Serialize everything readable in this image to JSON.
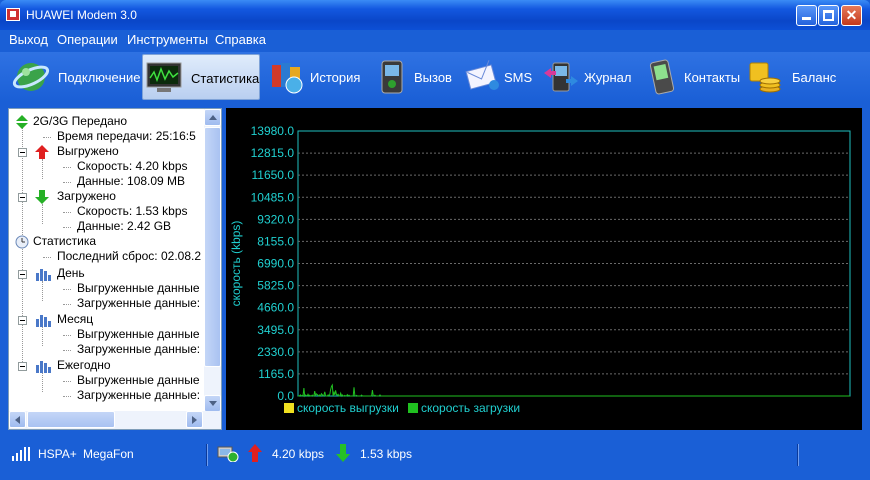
{
  "window": {
    "title": "HUAWEI Modem 3.0"
  },
  "menu": [
    "Выход",
    "Операции",
    "Инструменты",
    "Справка"
  ],
  "toolbar": [
    {
      "label": "Подключение",
      "icon": "connection-globe-icon"
    },
    {
      "label": "Статистика",
      "icon": "statistics-monitor-icon",
      "active": true
    },
    {
      "label": "История",
      "icon": "history-books-icon"
    },
    {
      "label": "Вызов",
      "icon": "call-phone-icon"
    },
    {
      "label": "SMS",
      "icon": "sms-envelope-icon"
    },
    {
      "label": "Журнал",
      "icon": "log-phone-arrows-icon"
    },
    {
      "label": "Контакты",
      "icon": "contacts-phone-icon"
    },
    {
      "label": "Баланс",
      "icon": "balance-coins-icon"
    }
  ],
  "tree": {
    "transferred": "2G/3G Передано",
    "time": "Время передачи: 25:16:5",
    "uploaded": "Выгружено",
    "up_speed": "Скорость: 4.20 kbps",
    "up_data": "Данные: 108.09 MB",
    "downloaded": "Загружено",
    "down_speed": "Скорость: 1.53 kbps",
    "down_data": "Данные: 2.42 GB",
    "statistics": "Статистика",
    "last_reset": "Последний сброс: 02.08.2",
    "day": "День",
    "day_up": "Выгруженные данные",
    "day_down": "Загруженные данные:",
    "month": "Месяц",
    "month_up": "Выгруженные данные",
    "month_down": "Загруженные данные:",
    "yearly": "Ежегодно",
    "year_up": "Выгруженные данные",
    "year_down": "Загруженные данные:"
  },
  "chart_data": {
    "type": "line",
    "ylabel": "скорость (kbps)",
    "ylim": [
      0,
      13980
    ],
    "y_ticks": [
      "13980.0",
      "12815.0",
      "11650.0",
      "10485.0",
      "9320.0",
      "8155.0",
      "6990.0",
      "5825.0",
      "4660.0",
      "3495.0",
      "2330.0",
      "1165.0",
      "0.0"
    ],
    "grid": true,
    "legend": [
      {
        "name": "скорость выгрузки",
        "color": "#f0e020"
      },
      {
        "name": "скорость загрузки",
        "color": "#20c020"
      }
    ],
    "series": [
      {
        "name": "скорость загрузки",
        "color": "#20c020",
        "values": [
          0,
          0,
          20,
          60,
          0,
          30,
          0,
          420,
          0,
          60,
          20,
          0,
          90,
          0,
          40,
          0,
          0,
          50,
          0,
          0,
          260,
          30,
          110,
          80,
          40,
          0,
          60,
          0,
          120,
          70,
          0,
          40,
          220,
          0,
          0,
          0,
          60,
          0,
          80,
          330,
          510,
          580,
          0,
          190,
          60,
          300,
          70,
          40,
          90,
          0,
          0,
          150,
          0,
          60,
          0,
          0,
          30,
          0,
          0,
          70,
          0,
          40,
          0,
          0,
          0,
          0,
          0,
          460,
          0,
          0,
          30,
          0,
          0,
          0,
          0,
          0,
          50,
          0,
          0,
          0,
          0,
          0,
          0,
          0,
          0,
          0,
          0,
          0,
          0,
          310,
          0,
          0,
          40,
          0,
          0,
          0,
          0,
          0,
          60,
          0,
          0,
          0,
          0,
          0,
          0,
          0,
          0,
          0,
          0,
          0,
          0,
          0,
          0,
          0,
          0,
          0,
          0,
          0,
          0,
          0,
          0,
          0,
          0,
          0,
          0,
          0,
          0,
          0,
          0,
          0,
          0,
          0,
          0,
          0,
          0,
          0,
          0,
          0,
          0,
          0,
          0,
          0,
          0,
          0,
          0,
          0,
          0,
          0,
          0,
          0,
          0,
          0,
          0,
          0,
          0,
          0,
          0,
          0,
          0,
          0,
          0,
          0,
          0,
          0,
          0,
          0,
          0,
          0,
          0,
          0,
          0,
          0,
          0,
          0,
          0,
          0,
          0,
          0,
          0,
          0,
          0,
          0,
          0,
          0,
          0,
          0,
          0,
          0,
          0,
          0,
          0,
          0,
          0,
          0,
          0,
          0,
          0,
          0,
          0,
          0,
          0,
          0,
          0,
          0,
          0,
          0,
          0,
          0,
          0,
          0,
          0,
          0,
          0,
          0,
          0,
          0,
          0,
          0,
          0,
          0,
          0,
          0,
          0,
          0,
          0,
          0,
          0,
          0,
          0,
          0,
          0,
          0,
          0,
          0,
          0,
          0,
          0,
          0,
          0,
          0,
          0,
          0,
          0,
          0,
          0,
          0,
          0,
          0,
          0,
          0,
          0,
          0,
          0,
          0,
          0,
          0,
          0,
          0,
          0,
          0,
          0,
          0,
          0,
          0,
          0,
          0,
          0,
          0,
          0,
          0,
          0,
          0,
          0,
          0,
          0,
          0,
          0,
          0,
          0,
          0,
          0,
          0,
          0,
          0,
          0,
          0,
          0,
          0,
          0,
          0,
          0,
          0,
          0,
          0,
          0,
          0,
          0,
          0,
          0,
          0,
          0,
          0,
          0,
          0,
          0,
          0,
          0,
          0,
          0,
          0,
          0,
          0,
          0,
          0,
          0,
          0,
          0,
          0,
          0,
          0,
          0,
          0,
          0,
          0,
          0,
          0,
          0,
          0,
          0,
          0,
          0,
          0,
          0,
          0,
          0,
          0,
          0,
          0,
          0,
          0,
          0,
          0,
          0,
          0,
          0,
          0,
          0,
          0,
          0,
          0,
          0,
          0,
          0,
          0,
          0,
          0,
          0,
          0,
          0,
          0,
          0,
          0,
          0,
          0,
          0,
          0,
          0,
          0,
          0,
          0,
          0,
          0,
          0,
          0,
          0,
          0,
          0,
          0,
          0,
          0,
          0,
          0,
          0,
          0,
          0,
          0,
          0,
          0,
          0,
          0,
          0,
          0,
          0,
          0,
          0,
          0,
          0,
          0,
          0,
          0,
          0,
          0,
          0,
          0,
          0,
          0,
          0,
          0,
          0,
          0,
          0,
          0,
          0,
          0,
          0,
          0,
          0,
          0,
          0,
          0,
          0,
          0,
          0,
          0,
          0,
          0,
          0,
          0,
          0,
          0,
          0,
          0,
          0,
          0,
          0,
          0,
          0,
          0,
          0,
          0,
          0,
          0,
          0,
          0,
          0,
          0,
          0,
          0,
          0,
          0,
          0,
          0,
          0,
          0,
          0,
          0,
          0,
          0,
          0,
          0,
          0,
          0,
          0,
          0,
          0,
          0,
          0,
          0,
          0,
          0,
          0,
          0,
          0,
          0,
          0,
          0,
          0,
          0,
          0,
          0,
          0,
          0,
          0,
          0,
          0,
          0,
          0,
          0,
          0,
          0,
          0,
          0,
          0,
          0,
          0,
          0,
          0,
          0,
          0,
          0,
          0,
          0,
          0,
          0,
          0,
          0,
          0,
          0,
          0,
          0,
          0,
          0,
          0,
          0,
          0,
          0,
          0,
          0,
          0,
          0,
          0,
          0,
          0,
          0,
          0,
          0,
          0,
          0,
          0,
          0,
          0,
          0,
          0,
          0,
          0,
          0,
          0,
          0,
          0,
          0,
          0,
          0,
          0,
          0,
          0,
          0,
          0,
          0,
          0,
          0,
          0,
          0,
          0,
          0,
          0,
          0,
          0,
          0,
          0,
          0,
          0,
          0,
          0,
          0,
          0,
          0,
          0,
          0,
          0,
          0,
          0,
          0,
          0,
          0,
          0,
          0,
          0,
          0,
          0,
          0,
          0,
          0,
          0,
          0,
          0,
          0,
          0,
          0,
          0,
          0,
          0,
          0,
          0,
          0,
          0,
          0,
          0,
          0,
          0,
          0,
          0,
          0,
          0,
          0,
          0,
          0,
          0,
          0,
          0,
          0,
          0,
          0,
          0,
          0,
          0,
          0,
          0,
          0,
          0,
          0,
          0,
          0,
          0,
          0,
          0,
          0,
          0,
          0,
          0,
          0,
          0,
          0,
          0,
          0,
          0,
          0,
          0,
          0,
          0,
          0,
          0,
          0,
          0,
          0,
          0,
          0,
          0,
          0,
          0,
          0,
          0,
          0,
          0,
          0,
          0,
          0,
          0,
          0,
          0,
          0,
          0
        ]
      },
      {
        "name": "скорость выгрузки",
        "color": "#f0e020",
        "values": [
          0
        ]
      }
    ]
  },
  "status": {
    "network": "HSPA+",
    "operator": "MegaFon",
    "up_speed": "4.20 kbps",
    "down_speed": "1.53 kbps"
  }
}
